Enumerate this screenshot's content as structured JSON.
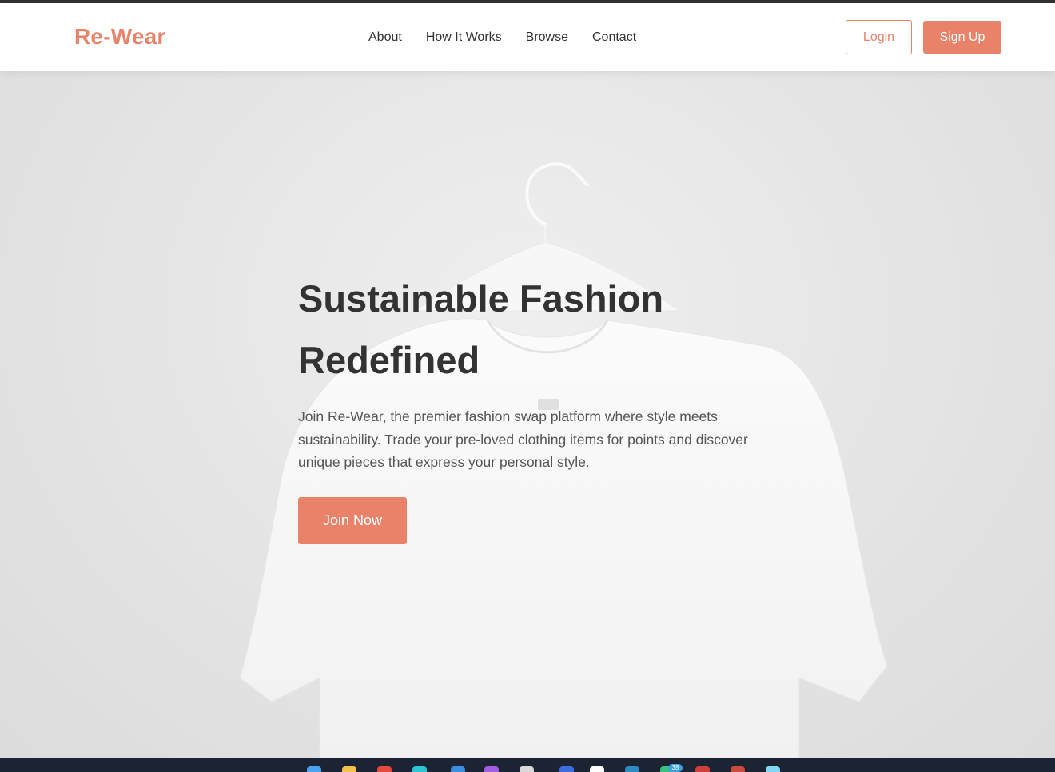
{
  "brand": {
    "name": "Re-Wear",
    "accent_color": "#e8836a",
    "text_color": "#333333"
  },
  "nav": {
    "links": [
      {
        "label": "About"
      },
      {
        "label": "How It Works"
      },
      {
        "label": "Browse"
      },
      {
        "label": "Contact"
      }
    ],
    "login_label": "Login",
    "signup_label": "Sign Up"
  },
  "hero": {
    "title_line1": "Sustainable Fashion",
    "title_line2": "Redefined",
    "description": "Join Re-Wear, the premier fashion swap platform where style meets sustainability. Trade your pre-loved clothing items for points and discover unique pieces that express your personal style.",
    "cta_label": "Join Now",
    "background_image": "white-tshirt-on-hanger"
  },
  "taskbar": {
    "icons": [
      "windows-icon",
      "folder-icon",
      "chrome-icon",
      "edge-icon",
      "vscode-icon",
      "app-icon",
      "settings-icon",
      "app-icon",
      "app-icon",
      "app-icon",
      "app-icon",
      "app-icon",
      "app-icon",
      "app-icon"
    ],
    "badge": "38"
  }
}
